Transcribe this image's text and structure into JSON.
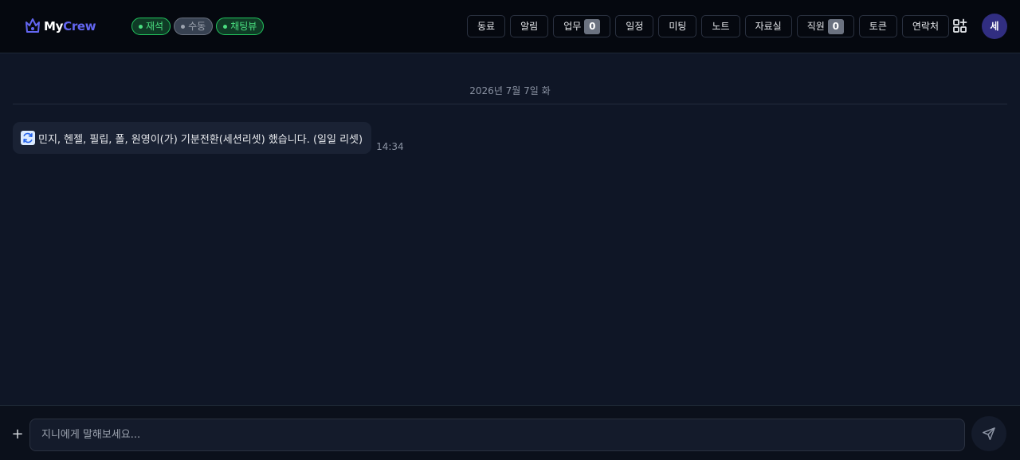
{
  "brand": {
    "name_part1": "My",
    "name_part2": "Crew",
    "color": "#6366f1"
  },
  "status_badges": [
    {
      "label": "재석",
      "state": "active"
    },
    {
      "label": "수동",
      "state": "inactive"
    },
    {
      "label": "채팅뷰",
      "state": "active"
    }
  ],
  "nav": {
    "colleagues": "동료",
    "alerts": "알림",
    "tasks": "업무",
    "tasks_count": "0",
    "schedule": "일정",
    "meeting": "미팅",
    "notes": "노트",
    "library": "자료실",
    "staff": "직원",
    "staff_count": "0",
    "tokens": "토큰",
    "contacts": "연락처"
  },
  "header_icons": {
    "apps": "apps-add-icon"
  },
  "user": {
    "avatar_initial": "세"
  },
  "chat": {
    "date": "2026년 7월 7일 화",
    "messages": [
      {
        "icon": "refresh-icon",
        "text": "민지, 헨젤, 필립, 폴, 원영이(가) 기분전환(세션리셋) 했습니다. (일일 리셋)",
        "time": "14:34"
      }
    ]
  },
  "composer": {
    "value": "",
    "placeholder": "지니에게 말해보세요...",
    "plus_icon": "plus-icon",
    "send_icon": "send-icon"
  },
  "colors": {
    "background": "#0f1626",
    "header": "#05080f",
    "online_green": "#4ade80",
    "bubble": "#1a2234"
  }
}
